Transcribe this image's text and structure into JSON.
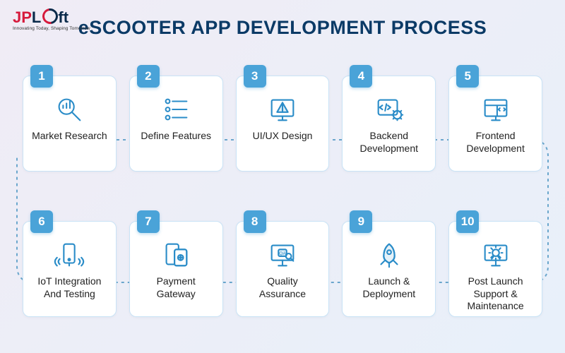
{
  "brand": {
    "name_a": "JP",
    "name_b": "L",
    "name_c": "ft",
    "tagline": "Innovating Today, Shaping Tomorrow"
  },
  "title": "eSCOOTER APP DEVELOPMENT PROCESS",
  "steps": [
    {
      "n": "1",
      "label": "Market Research",
      "icon": "research"
    },
    {
      "n": "2",
      "label": "Define Features",
      "icon": "features"
    },
    {
      "n": "3",
      "label": "UI/UX Design",
      "icon": "design"
    },
    {
      "n": "4",
      "label": "Backend Development",
      "icon": "backend"
    },
    {
      "n": "5",
      "label": "Frontend Development",
      "icon": "frontend"
    },
    {
      "n": "6",
      "label": "IoT Integration And Testing",
      "icon": "iot"
    },
    {
      "n": "7",
      "label": "Payment Gateway",
      "icon": "payment"
    },
    {
      "n": "8",
      "label": "Quality Assurance",
      "icon": "qa"
    },
    {
      "n": "9",
      "label": "Launch & Deployment",
      "icon": "launch"
    },
    {
      "n": "10",
      "label": "Post Launch Support & Maintenance",
      "icon": "support"
    }
  ],
  "theme": {
    "accent": "#4aa3d8",
    "icon": "#2a8cc8",
    "heading": "#0b3a66",
    "cardBorder": "#c9e3f6",
    "connector": "#6aa6cc"
  }
}
